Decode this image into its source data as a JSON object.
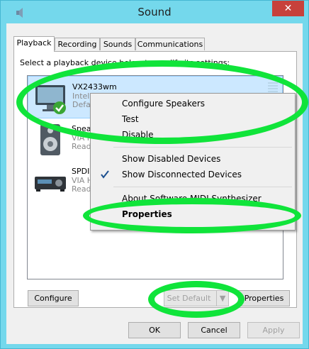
{
  "window": {
    "title": "Sound",
    "close_glyph": "✕"
  },
  "tabs": [
    {
      "label": "Playback",
      "active": true
    },
    {
      "label": "Recording"
    },
    {
      "label": "Sounds"
    },
    {
      "label": "Communications"
    }
  ],
  "instruction": "Select a playback device below to modify its settings:",
  "devices": [
    {
      "name": "VX2433wm",
      "line2": "Intel",
      "line3": "Defa",
      "icon": "monitor-icon",
      "selected": true
    },
    {
      "name": "Spea",
      "line2": "VIA H",
      "line3": "Read",
      "icon": "speaker-icon"
    },
    {
      "name": "SPDIF",
      "line2": "VIA H",
      "line3": "Read",
      "icon": "spdif-device-icon"
    }
  ],
  "context_menu": {
    "items": [
      {
        "label": "Configure Speakers"
      },
      {
        "label": "Test"
      },
      {
        "label": "Disable"
      },
      {
        "label": "Show Disabled Devices"
      },
      {
        "label": "Show Disconnected Devices",
        "checked": true
      },
      {
        "label": "About Software MIDI Synthesizer"
      },
      {
        "label": "Properties",
        "bold": true
      }
    ]
  },
  "buttons": {
    "configure": "Configure",
    "set_default": "Set Default",
    "properties": "Properties",
    "ok": "OK",
    "cancel": "Cancel",
    "apply": "Apply"
  },
  "colors": {
    "highlight": "#10e43a",
    "title_bar": "#74d8ec",
    "close": "#c7413b",
    "selection": "#cce8ff"
  }
}
